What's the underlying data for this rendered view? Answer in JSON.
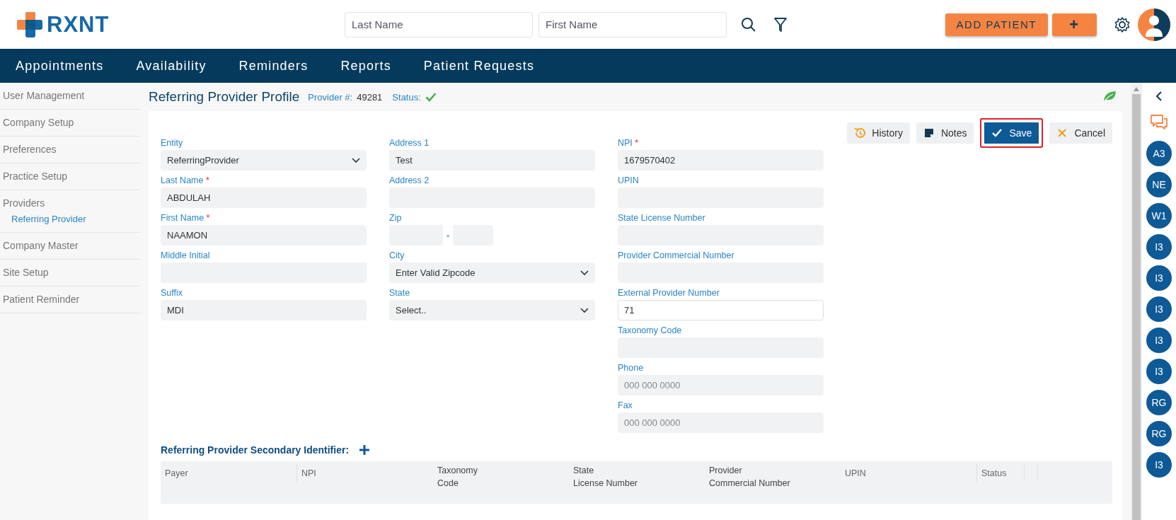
{
  "header": {
    "logo_text": "RXNT",
    "search_fields": [
      {
        "placeholder": "Last Name"
      },
      {
        "placeholder": "First Name"
      }
    ],
    "add_button": "ADD PATIENT",
    "plus_button": "+"
  },
  "nav": {
    "items": [
      "Appointments",
      "Availability",
      "Reminders",
      "Reports",
      "Patient Requests"
    ]
  },
  "sidebar": {
    "items": [
      {
        "label": "User Management",
        "selected": false
      },
      {
        "label": "Company Setup",
        "selected": false
      },
      {
        "label": "Preferences",
        "selected": false
      },
      {
        "label": "Practice Setup",
        "selected": false
      },
      {
        "label": "Providers",
        "selected": false,
        "children": [
          {
            "label": "Referring Provider",
            "selected": true
          }
        ]
      },
      {
        "label": "Company Master",
        "selected": false
      },
      {
        "label": "Site Setup",
        "selected": false
      },
      {
        "label": "Patient Reminder",
        "selected": false
      }
    ]
  },
  "page": {
    "title": "Referring Provider Profile",
    "provider_label": "Provider #:",
    "provider_number": "49281",
    "status_label": "Status:",
    "status_active": true
  },
  "actions": [
    {
      "label": "History",
      "kind": "history",
      "highlighted": false
    },
    {
      "label": "Notes",
      "kind": "notes",
      "highlighted": false
    },
    {
      "label": "Save",
      "kind": "save",
      "highlighted": true
    },
    {
      "label": "Cancel",
      "kind": "cancel",
      "highlighted": false
    }
  ],
  "form": {
    "columns": [
      [
        {
          "label": "Entity",
          "kind": "select",
          "value": "ReferringProvider",
          "focused": false
        },
        {
          "label": "Last Name",
          "kind": "text",
          "value": "ABDULAH",
          "required_mark": "*",
          "focused": false
        },
        {
          "label": "First Name",
          "kind": "text",
          "value": "NAAMON",
          "required_mark": "*",
          "focused": false
        },
        {
          "label": "Middle Initial",
          "kind": "text",
          "focused": false
        },
        {
          "label": "Suffix",
          "kind": "text",
          "value": "MDI",
          "focused": false
        }
      ],
      [
        {
          "label": "Address 1",
          "kind": "text",
          "value": "Test",
          "focused": false
        },
        {
          "label": "Address 2",
          "kind": "text",
          "focused": false
        },
        {
          "label": "Zip",
          "kind": "zip",
          "separator": "-",
          "focused": false
        },
        {
          "label": "City",
          "kind": "select",
          "value": "Enter Valid Zipcode",
          "focused": false
        },
        {
          "label": "State",
          "kind": "select",
          "value": "Select..",
          "focused": false
        }
      ],
      [
        {
          "label": "NPI",
          "kind": "text",
          "value": "1679570402",
          "required_mark": "*",
          "focused": false
        },
        {
          "label": "UPIN",
          "kind": "text",
          "focused": false
        },
        {
          "label": "State License Number",
          "kind": "text",
          "focused": false
        },
        {
          "label": "Provider Commercial Number",
          "kind": "text",
          "focused": false
        },
        {
          "label": "External Provider Number",
          "kind": "text",
          "value": "71",
          "focused": true
        },
        {
          "label": "Taxonomy Code",
          "kind": "text",
          "focused": false
        },
        {
          "label": "Phone",
          "kind": "text",
          "placeholder": "000 000 0000",
          "focused": false
        },
        {
          "label": "Fax",
          "kind": "text",
          "placeholder": "000 000 0000",
          "focused": false
        }
      ]
    ]
  },
  "secondary": {
    "title": "Referring Provider Secondary Identifier:",
    "table": {
      "columns": [
        "Payer",
        "NPI",
        "Taxonomy\nCode",
        "State\nLicense Number",
        "Provider\nCommercial Number",
        "UPIN",
        "Status"
      ]
    }
  },
  "rail": {
    "avatars": [
      "A3",
      "NE",
      "W1",
      "I3",
      "I3",
      "I3",
      "I3",
      "I3",
      "RG",
      "RG",
      "I3"
    ]
  }
}
